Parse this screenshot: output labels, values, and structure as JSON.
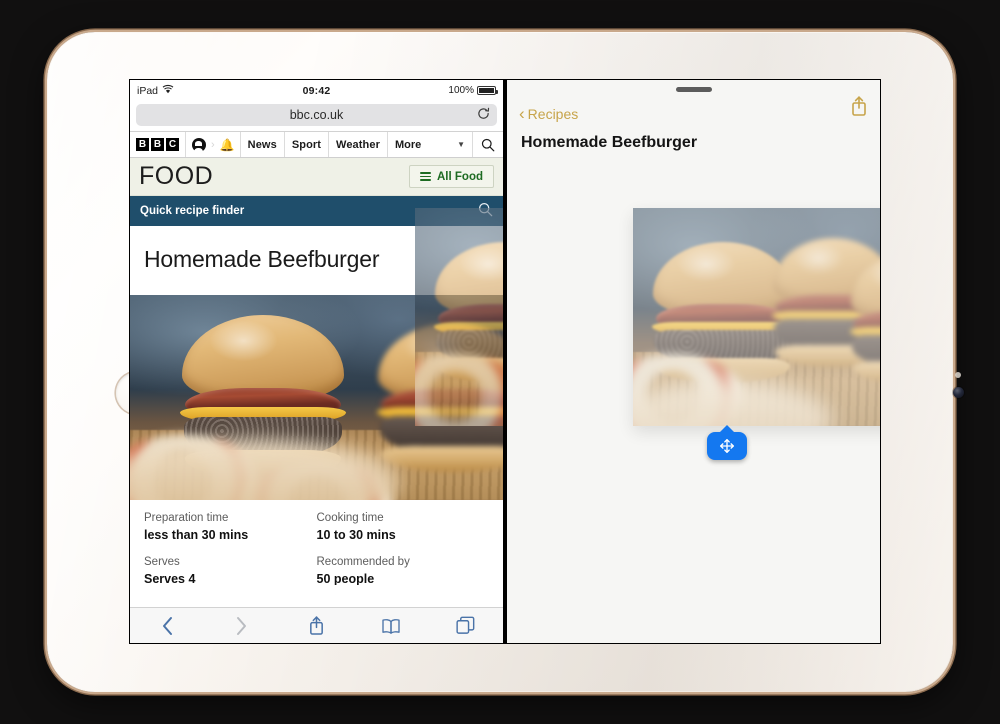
{
  "device": {
    "name": "iPad",
    "home_button": "home-button",
    "camera": "front-camera"
  },
  "left_pane": {
    "status_bar": {
      "carrier": "iPad",
      "wifi_icon": "wifi-icon",
      "time": "09:42",
      "battery_percent": "100%",
      "battery_icon": "battery-icon"
    },
    "safari": {
      "url": "bbc.co.uk",
      "reload_icon": "reload-icon",
      "toolbar": {
        "back_icon": "back-chevron-icon",
        "forward_icon": "forward-chevron-icon",
        "share_icon": "share-icon",
        "bookmarks_icon": "book-icon",
        "tabs_icon": "tabs-icon"
      }
    },
    "bbc_nav": {
      "logo_letters": [
        "B",
        "B",
        "C"
      ],
      "account_icon": "account-icon",
      "notifications_icon": "bell-icon",
      "items": [
        "News",
        "Sport",
        "Weather"
      ],
      "more_label": "More",
      "more_caret": "chevron-down-icon",
      "search_icon": "search-icon"
    },
    "brand_bar": {
      "title": "FOOD",
      "menu_label": "All Food",
      "menu_icon": "hamburger-icon"
    },
    "quick_finder": {
      "label": "Quick recipe finder",
      "search_icon": "search-icon"
    },
    "recipe": {
      "title": "Homemade Beefburger",
      "photo_alt": "beefburger-photo",
      "meta": [
        {
          "label": "Preparation time",
          "value": "less than 30 mins"
        },
        {
          "label": "Cooking time",
          "value": "10 to 30 mins"
        },
        {
          "label": "Serves",
          "value": "Serves 4"
        },
        {
          "label": "Recommended by",
          "value": "50 people"
        }
      ]
    }
  },
  "right_pane": {
    "grabber": "drag-handle",
    "back_label": "Recipes",
    "back_icon": "back-chevron-icon",
    "share_icon": "share-icon",
    "title": "Homemade Beefburger",
    "dragged_item": "beefburger-photo",
    "drag_badge_icon": "move-arrows-icon"
  },
  "colors": {
    "bbc_food_bar": "#eff1e7",
    "all_food_green": "#1d6b22",
    "quick_finder_blue": "#1f4e6b",
    "safari_tint": "#4a73a8",
    "notes_gold": "#c7a44a",
    "drag_badge_blue": "#1478f0"
  }
}
